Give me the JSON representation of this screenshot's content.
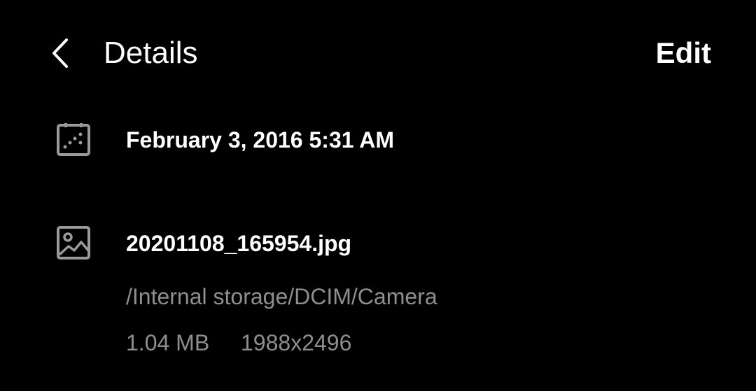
{
  "header": {
    "back_icon": "chevron-left-icon",
    "title": "Details",
    "edit_label": "Edit"
  },
  "date_row": {
    "icon": "calendar-icon",
    "value": "February 3, 2016 5:31 AM"
  },
  "file_row": {
    "icon": "image-icon",
    "filename": "20201108_165954.jpg",
    "path": "/Internal storage/DCIM/Camera",
    "size": "1.04 MB",
    "resolution": "1988x2496"
  },
  "colors": {
    "background": "#000000",
    "primary_text": "#ffffff",
    "secondary_text": "#8e8e8e",
    "icon": "#9a9a9a"
  }
}
